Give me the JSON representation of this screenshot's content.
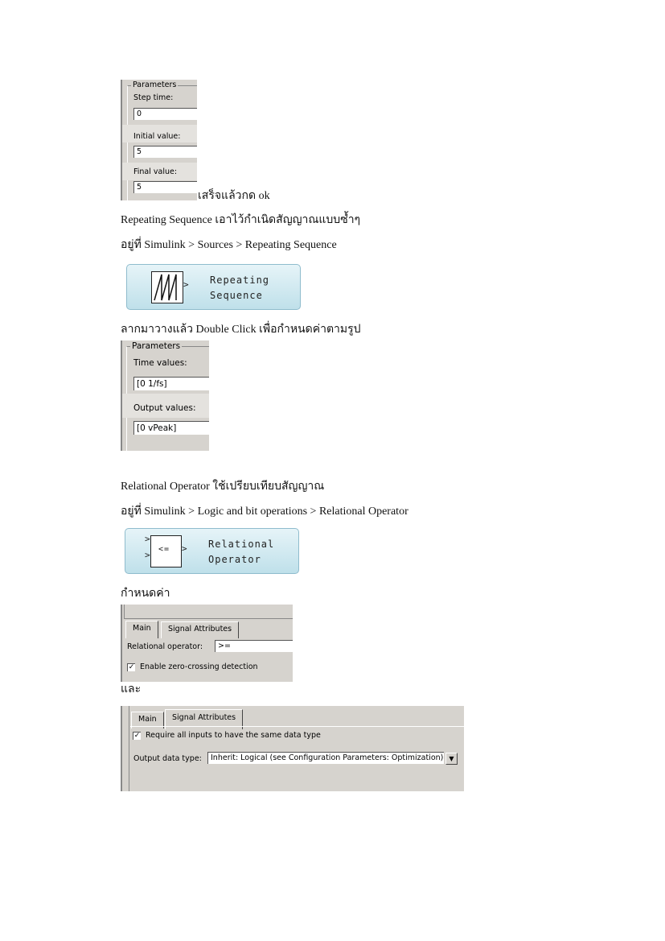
{
  "step_dialog": {
    "group": "Parameters",
    "step_time_label": "Step time:",
    "step_time": "0",
    "initial_label": "Initial value:",
    "initial": "5",
    "final_label": "Final value:",
    "final": "5"
  },
  "text": {
    "done_ok": "เสร็จแล้วกด ok",
    "repeat_intro": "Repeating Sequence  เอาไว้กำเนิดสัญญาณแบบซ้ำๆ",
    "repeat_path": "อยู่ที่ Simulink > Sources > Repeating Sequence",
    "drag_instr": "ลากมาวางแล้ว Double Click เพื่อกำหนดค่าตามรูป",
    "rel_intro": "Relational Operator ใช้เปรียบเทียบสัญญาณ",
    "rel_path": "อยู่ที่ Simulink > Logic and bit operations > Relational Operator",
    "set_value": "กำหนดค่า",
    "and": "และ"
  },
  "repeat_block": {
    "line1": "Repeating",
    "line2": "Sequence"
  },
  "repeat_dialog": {
    "group": "Parameters",
    "time_label": "Time values:",
    "time": "[0 1/fs]",
    "output_label": "Output values:",
    "output": "[0 vPeak]"
  },
  "rel_block": {
    "symbol": "<=",
    "line1": "Relational",
    "line2": "Operator"
  },
  "rel_main_dialog": {
    "tab_main": "Main",
    "tab_signal": "Signal Attributes",
    "op_label": "Relational operator:",
    "op": ">=",
    "zero_cross": "Enable zero-crossing detection",
    "zero_cross_checked": true
  },
  "rel_signal_dialog": {
    "tab_main": "Main",
    "tab_signal": "Signal Attributes",
    "require_same": "Require all inputs to have the same data type",
    "require_checked": true,
    "out_label": "Output data type:",
    "out_value": "Inherit: Logical (see Configuration Parameters: Optimization)",
    "dropdown_icon": "chevron-down-icon"
  }
}
